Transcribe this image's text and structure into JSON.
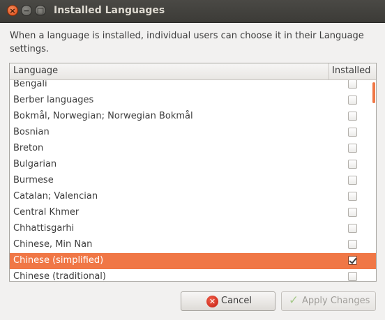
{
  "window": {
    "title": "Installed Languages",
    "close_icon": "close-icon",
    "minimize_icon": "minimize-icon",
    "maximize_icon": "maximize-icon"
  },
  "description": "When a language is installed, individual users can choose it in their Language settings.",
  "table": {
    "columns": [
      "Language",
      "Installed"
    ],
    "rows": [
      {
        "language": "Bengali",
        "installed": false
      },
      {
        "language": "Berber languages",
        "installed": false
      },
      {
        "language": "Bokmål, Norwegian; Norwegian Bokmål",
        "installed": false
      },
      {
        "language": "Bosnian",
        "installed": false
      },
      {
        "language": "Breton",
        "installed": false
      },
      {
        "language": "Bulgarian",
        "installed": false
      },
      {
        "language": "Burmese",
        "installed": false
      },
      {
        "language": "Catalan; Valencian",
        "installed": false
      },
      {
        "language": "Central Khmer",
        "installed": false
      },
      {
        "language": "Chhattisgarhi",
        "installed": false
      },
      {
        "language": "Chinese, Min Nan",
        "installed": false
      },
      {
        "language": "Chinese (simplified)",
        "installed": true,
        "selected": true
      },
      {
        "language": "Chinese (traditional)",
        "installed": false
      }
    ]
  },
  "buttons": {
    "cancel": "Cancel",
    "apply": "Apply Changes",
    "apply_enabled": false
  },
  "colors": {
    "selection": "#f07746",
    "titlebar": "#3c3b37"
  }
}
